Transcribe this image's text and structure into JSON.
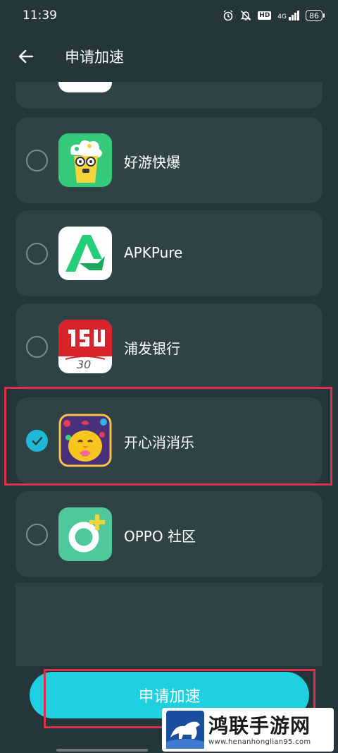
{
  "status_bar": {
    "time": "11:39",
    "network": "4G",
    "hd": "HD",
    "battery": "86"
  },
  "header": {
    "title": "申请加速"
  },
  "apps": [
    {
      "name": "好游快爆",
      "selected": false
    },
    {
      "name": "APKPure",
      "selected": false
    },
    {
      "name": "浦发银行",
      "selected": false
    },
    {
      "name": "开心消消乐",
      "selected": true
    },
    {
      "name": "OPPO 社区",
      "selected": false
    }
  ],
  "pufa_icon_text": "30",
  "apply_button": {
    "label": "申请加速"
  },
  "watermark": {
    "title": "鸿联手游网",
    "url": "www.henanhonglian95.com"
  },
  "colors": {
    "background": "#24363a",
    "card": "#2f4347",
    "accent": "#1fd0e0",
    "highlight": "#d9304b"
  }
}
